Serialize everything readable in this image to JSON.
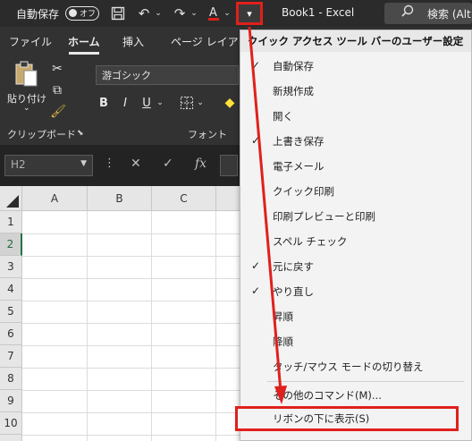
{
  "titlebar": {
    "autosave_label": "自動保存",
    "autosave_toggle": "オフ",
    "book_title": "Book1  -  Excel",
    "search_label": "検索 (Alt",
    "customize_glyph": "▾"
  },
  "ribbon_tabs": [
    "ファイル",
    "ホーム",
    "挿入",
    "ページ レイアウ"
  ],
  "ribbon": {
    "paste_label": "貼り付け",
    "clipboard_group": "クリップボード",
    "font_group": "フォント",
    "font_name": "游ゴシック",
    "bold": "B",
    "italic": "I",
    "underline": "U"
  },
  "formula_bar": {
    "name_box": "H2",
    "fx": "fx"
  },
  "grid": {
    "columns": [
      "A",
      "B",
      "C"
    ],
    "rows": [
      "1",
      "2",
      "3",
      "4",
      "5",
      "6",
      "7",
      "8",
      "9",
      "10"
    ],
    "selected_row": "2"
  },
  "menu": {
    "header": "クイック アクセス ツール バーのユーザー設定",
    "items": [
      {
        "label": "自動保存",
        "checked": true
      },
      {
        "label": "新規作成",
        "checked": false
      },
      {
        "label": "開く",
        "checked": false
      },
      {
        "label": "上書き保存",
        "checked": true
      },
      {
        "label": "電子メール",
        "checked": false
      },
      {
        "label": "クイック印刷",
        "checked": false
      },
      {
        "label": "印刷プレビューと印刷",
        "checked": false
      },
      {
        "label": "スペル チェック",
        "checked": false
      },
      {
        "label": "元に戻す",
        "checked": true
      },
      {
        "label": "やり直し",
        "checked": true
      },
      {
        "label": "昇順",
        "checked": false
      },
      {
        "label": "降順",
        "checked": false
      },
      {
        "label": "タッチ/マウス モードの切り替え",
        "checked": false
      }
    ],
    "more_commands": "その他のコマンド(M)...",
    "show_below": "リボンの下に表示(S)"
  },
  "colors": {
    "annotation": "#e0201c",
    "excel_green": "#217346"
  }
}
